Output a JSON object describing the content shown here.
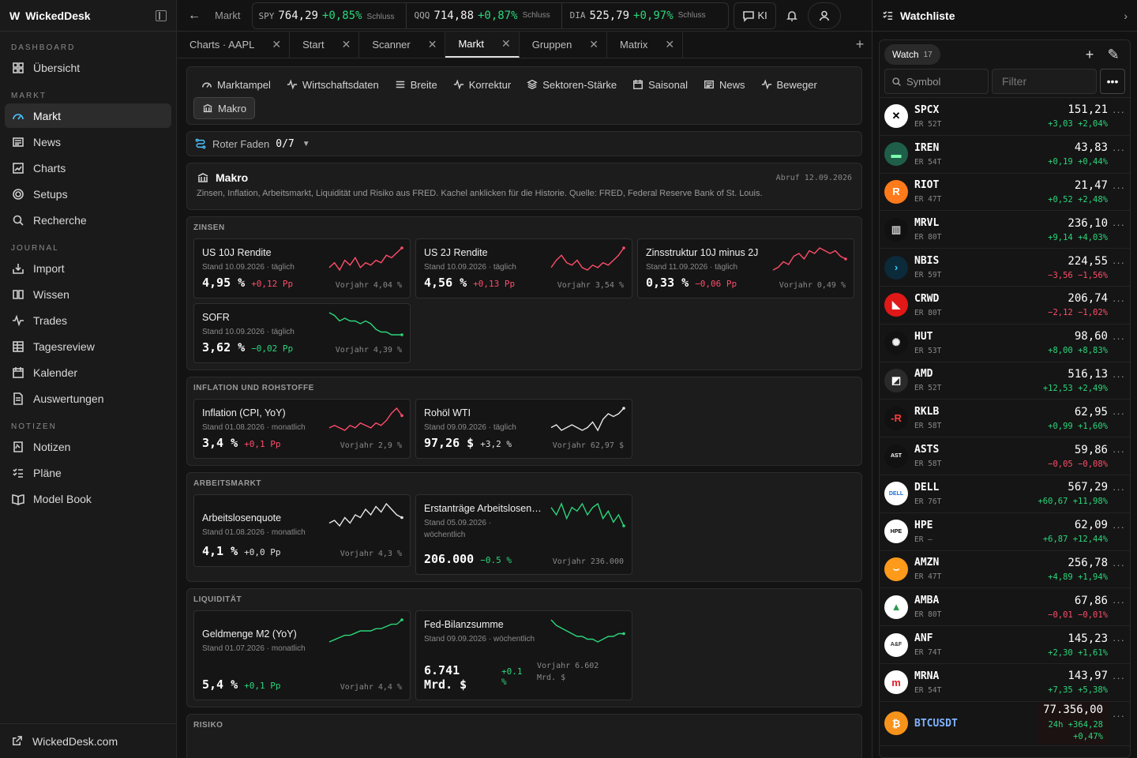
{
  "brand": {
    "logo": "W",
    "name": "WickedDesk"
  },
  "sidebar": {
    "sections": [
      {
        "title": "DASHBOARD",
        "items": [
          {
            "label": "Übersicht",
            "icon": "grid-icon"
          }
        ]
      },
      {
        "title": "MARKT",
        "items": [
          {
            "label": "Markt",
            "icon": "gauge-icon",
            "active": true
          },
          {
            "label": "News",
            "icon": "newspaper-icon"
          },
          {
            "label": "Charts",
            "icon": "chart-icon"
          },
          {
            "label": "Setups",
            "icon": "target-icon"
          },
          {
            "label": "Recherche",
            "icon": "search-icon"
          }
        ]
      },
      {
        "title": "JOURNAL",
        "items": [
          {
            "label": "Import",
            "icon": "import-icon"
          },
          {
            "label": "Wissen",
            "icon": "book-icon"
          },
          {
            "label": "Trades",
            "icon": "pulse-icon"
          },
          {
            "label": "Tagesreview",
            "icon": "table-icon"
          },
          {
            "label": "Kalender",
            "icon": "calendar-icon"
          },
          {
            "label": "Auswertungen",
            "icon": "document-icon"
          }
        ]
      },
      {
        "title": "NOTIZEN",
        "items": [
          {
            "label": "Notizen",
            "icon": "note-icon"
          },
          {
            "label": "Pläne",
            "icon": "checklist-icon"
          },
          {
            "label": "Model Book",
            "icon": "open-book-icon"
          }
        ]
      }
    ],
    "footer": "WickedDesk.com"
  },
  "topbar": {
    "crumb": "Markt",
    "tickers": [
      {
        "sym": "SPY",
        "price": "764,29",
        "change": "+0,85%",
        "status": "Schluss"
      },
      {
        "sym": "QQQ",
        "price": "714,88",
        "change": "+0,87%",
        "status": "Schluss"
      },
      {
        "sym": "DIA",
        "price": "525,79",
        "change": "+0,97%",
        "status": "Schluss"
      }
    ],
    "ki_label": "KI"
  },
  "tabs": [
    {
      "label": "Charts · AAPL"
    },
    {
      "label": "Start"
    },
    {
      "label": "Scanner"
    },
    {
      "label": "Markt",
      "active": true
    },
    {
      "label": "Gruppen"
    },
    {
      "label": "Matrix"
    }
  ],
  "subnav": [
    {
      "label": "Marktampel",
      "icon": "gauge-icon"
    },
    {
      "label": "Wirtschaftsdaten",
      "icon": "pulse-icon"
    },
    {
      "label": "Breite",
      "icon": "bars-icon"
    },
    {
      "label": "Korrektur",
      "icon": "pulse-icon"
    },
    {
      "label": "Sektoren-Stärke",
      "icon": "layers-icon"
    },
    {
      "label": "Saisonal",
      "icon": "calendar-icon"
    },
    {
      "label": "News",
      "icon": "newspaper-icon"
    },
    {
      "label": "Beweger",
      "icon": "pulse-icon"
    },
    {
      "label": "Makro",
      "icon": "bank-icon",
      "active": true
    }
  ],
  "faden": {
    "label": "Roter Faden",
    "progress": "0/7"
  },
  "makro": {
    "title": "Makro",
    "fetched": "Abruf 12.09.2026",
    "desc": "Zinsen, Inflation, Arbeitsmarkt, Liquidität und Risiko aus FRED. Kachel anklicken für die Historie. Quelle: FRED, Federal Reserve Bank of St. Louis."
  },
  "groups": [
    {
      "title": "ZINSEN",
      "cards": [
        {
          "title": "US 10J Rendite",
          "stand": "Stand 10.09.2026 · täglich",
          "value": "4,95 %",
          "delta": "+0,12 Pp",
          "dir": "dn",
          "prev": "Vorjahr 4,04 %",
          "spark": [
            5,
            7,
            4,
            8,
            6,
            9,
            5,
            7,
            6,
            8,
            7,
            10,
            9,
            11,
            13
          ],
          "color": "#ff4d6a"
        },
        {
          "title": "US 2J Rendite",
          "stand": "Stand 10.09.2026 · täglich",
          "value": "4,56 %",
          "delta": "+0,13 Pp",
          "dir": "dn",
          "prev": "Vorjahr 3,54 %",
          "spark": [
            6,
            9,
            11,
            8,
            7,
            9,
            6,
            5,
            7,
            6,
            8,
            7,
            9,
            11,
            14
          ],
          "color": "#ff4d6a"
        },
        {
          "title": "Zinsstruktur 10J minus 2J",
          "stand": "Stand 11.09.2026 · täglich",
          "value": "0,33 %",
          "delta": "−0,06 Pp",
          "dir": "dn",
          "prev": "Vorjahr 0,49 %",
          "spark": [
            3,
            4,
            6,
            5,
            8,
            9,
            7,
            10,
            9,
            11,
            10,
            9,
            10,
            8,
            7
          ],
          "color": "#ff4d6a"
        },
        {
          "title": "SOFR",
          "stand": "Stand 10.09.2026 · täglich",
          "value": "3,62 %",
          "delta": "−0,02 Pp",
          "dir": "up",
          "prev": "Vorjahr 4,39 %",
          "spark": [
            12,
            11,
            9,
            10,
            9,
            9,
            8,
            9,
            8,
            6,
            5,
            5,
            4,
            4,
            4
          ],
          "color": "#2bd67b"
        }
      ]
    },
    {
      "title": "INFLATION UND ROHSTOFFE",
      "cards": [
        {
          "title": "Inflation (CPI, YoY)",
          "stand": "Stand 01.08.2026 · monatlich",
          "value": "3,4 %",
          "delta": "+0,1 Pp",
          "dir": "dn",
          "prev": "Vorjahr 2,9 %",
          "spark": [
            5,
            6,
            5,
            4,
            6,
            5,
            7,
            6,
            5,
            7,
            6,
            8,
            11,
            13,
            10
          ],
          "color": "#ff4d6a"
        },
        {
          "title": "Rohöl WTI",
          "stand": "Stand 09.09.2026 · täglich",
          "value": "97,26 $",
          "delta": "+3,2 %",
          "dir": "neu",
          "prev": "Vorjahr 62,97 $",
          "spark": [
            7,
            8,
            6,
            7,
            8,
            7,
            6,
            7,
            9,
            6,
            10,
            12,
            11,
            12,
            14
          ],
          "color": "#e8e8e8"
        }
      ]
    },
    {
      "title": "ARBEITSMARKT",
      "cards": [
        {
          "title": "Arbeitslosenquote",
          "stand": "Stand 01.08.2026 · monatlich",
          "value": "4,1 %",
          "delta": "+0,0 Pp",
          "dir": "neu",
          "prev": "Vorjahr 4,3 %",
          "spark": [
            5,
            6,
            4,
            7,
            5,
            8,
            7,
            10,
            8,
            11,
            9,
            12,
            10,
            8,
            7
          ],
          "color": "#e8e8e8"
        },
        {
          "title": "Erstanträge Arbeitslosenhilfe",
          "stand": "Stand 05.09.2026 · wöchentlich",
          "value": "206.000",
          "delta": "−0.5 %",
          "dir": "up",
          "prev": "Vorjahr 236.000",
          "spark": [
            12,
            10,
            13,
            9,
            12,
            11,
            13,
            10,
            12,
            13,
            9,
            11,
            8,
            10,
            7
          ],
          "color": "#2bd67b"
        }
      ]
    },
    {
      "title": "LIQUIDITÄT",
      "cards": [
        {
          "title": "Geldmenge M2 (YoY)",
          "stand": "Stand 01.07.2026 · monatlich",
          "value": "5,4 %",
          "delta": "+0,1 Pp",
          "dir": "up",
          "prev": "Vorjahr 4,4 %",
          "spark": [
            3,
            4,
            5,
            6,
            6,
            7,
            8,
            8,
            8,
            9,
            9,
            10,
            11,
            11,
            13
          ],
          "color": "#2bd67b"
        },
        {
          "title": "Fed-Bilanzsumme",
          "stand": "Stand 09.09.2026 · wöchentlich",
          "value": "6.741 Mrd. $",
          "delta": "+0.1 %",
          "dir": "up",
          "prev": "Vorjahr 6.602 Mrd. $",
          "spark": [
            13,
            11,
            10,
            9,
            8,
            7,
            7,
            6,
            6,
            5,
            6,
            7,
            7,
            8,
            8
          ],
          "color": "#2bd67b"
        }
      ]
    },
    {
      "title": "RISIKO",
      "cards": []
    }
  ],
  "watchlist": {
    "title": "Watchliste",
    "chip": "Watch",
    "count": "17",
    "symbol_placeholder": "Symbol",
    "filter_placeholder": "Filter",
    "items": [
      {
        "sym": "SPCX",
        "er": "ER 52T",
        "price": "151,21",
        "change": "+3,03 +2,04%",
        "dir": "up",
        "bg": "#ffffff",
        "fg": "#000",
        "mark": "✕"
      },
      {
        "sym": "IREN",
        "er": "ER 54T",
        "price": "43,83",
        "change": "+0,19 +0,44%",
        "dir": "up",
        "bg": "#1f5f4a",
        "fg": "#7dffb0",
        "mark": "▬"
      },
      {
        "sym": "RIOT",
        "er": "ER 47T",
        "price": "21,47",
        "change": "+0,52 +2,48%",
        "dir": "up",
        "bg": "#ff7a1a",
        "fg": "#fff",
        "mark": "R"
      },
      {
        "sym": "MRVL",
        "er": "ER 80T",
        "price": "236,10",
        "change": "+9,14 +4,03%",
        "dir": "up",
        "bg": "#111",
        "fg": "#ccc",
        "mark": "▥"
      },
      {
        "sym": "NBIS",
        "er": "ER 59T",
        "price": "224,55",
        "change": "−3,56 −1,56%",
        "dir": "dn",
        "bg": "#0b2a3a",
        "fg": "#3ad0ff",
        "mark": "›"
      },
      {
        "sym": "CRWD",
        "er": "ER 80T",
        "price": "206,74",
        "change": "−2,12 −1,02%",
        "dir": "dn",
        "bg": "#e01818",
        "fg": "#fff",
        "mark": "◣"
      },
      {
        "sym": "HUT",
        "er": "ER 53T",
        "price": "98,60",
        "change": "+8,00 +8,83%",
        "dir": "up",
        "bg": "#111",
        "fg": "#eee",
        "mark": "✺"
      },
      {
        "sym": "AMD",
        "er": "ER 52T",
        "price": "516,13",
        "change": "+12,53 +2,49%",
        "dir": "up",
        "bg": "#2a2a2a",
        "fg": "#fff",
        "mark": "◩"
      },
      {
        "sym": "RKLB",
        "er": "ER 58T",
        "price": "62,95",
        "change": "+0,99 +1,60%",
        "dir": "up",
        "bg": "#111",
        "fg": "#ff3b3b",
        "mark": "-R"
      },
      {
        "sym": "ASTS",
        "er": "ER 58T",
        "price": "59,86",
        "change": "−0,05 −0,08%",
        "dir": "dn",
        "bg": "#111",
        "fg": "#fff",
        "mark": "AST"
      },
      {
        "sym": "DELL",
        "er": "ER 76T",
        "price": "567,29",
        "change": "+60,67 +11,98%",
        "dir": "up",
        "bg": "#ffffff",
        "fg": "#1a6fd1",
        "mark": "DELL"
      },
      {
        "sym": "HPE",
        "er": "ER –",
        "price": "62,09",
        "change": "+6,87 +12,44%",
        "dir": "up",
        "bg": "#ffffff",
        "fg": "#000",
        "mark": "HPE"
      },
      {
        "sym": "AMZN",
        "er": "ER 47T",
        "price": "256,78",
        "change": "+4,89 +1,94%",
        "dir": "up",
        "bg": "#ff9a1a",
        "fg": "#fff",
        "mark": "⌣"
      },
      {
        "sym": "AMBA",
        "er": "ER 80T",
        "price": "67,86",
        "change": "−0,01 −0,01%",
        "dir": "dn",
        "bg": "#ffffff",
        "fg": "#2b9a4a",
        "mark": "▲"
      },
      {
        "sym": "ANF",
        "er": "ER 74T",
        "price": "145,23",
        "change": "+2,30 +1,61%",
        "dir": "up",
        "bg": "#ffffff",
        "fg": "#333",
        "mark": "A&F"
      },
      {
        "sym": "MRNA",
        "er": "ER 54T",
        "price": "143,97",
        "change": "+7,35 +5,38%",
        "dir": "up",
        "bg": "#ffffff",
        "fg": "#e0202a",
        "mark": "m"
      },
      {
        "sym": "BTCUSDT",
        "er": "",
        "price": "77.356,00",
        "change": "24h +364,28 +0,47%",
        "dir": "up",
        "bg": "#f7931a",
        "fg": "#fff",
        "mark": "₿",
        "btc": true
      }
    ]
  }
}
